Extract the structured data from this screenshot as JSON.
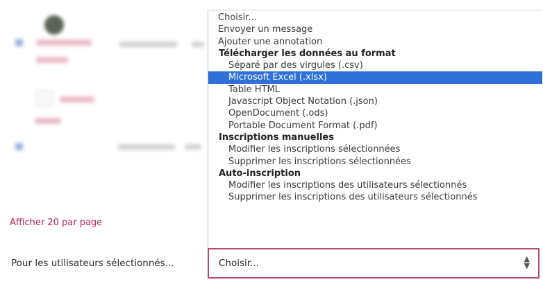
{
  "afficher_link": "Afficher 20 par page",
  "bulk_action_label": "Pour les utilisateurs sélectionnés...",
  "select": {
    "value": "Choisir..."
  },
  "dropdown": {
    "items": [
      {
        "label": "Choisir...",
        "type": "option",
        "indent": false,
        "selected": false
      },
      {
        "label": "Envoyer un message",
        "type": "option",
        "indent": false,
        "selected": false
      },
      {
        "label": "Ajouter une annotation",
        "type": "option",
        "indent": false,
        "selected": false
      },
      {
        "label": "Télécharger les données au format",
        "type": "group",
        "indent": false,
        "selected": false
      },
      {
        "label": "Séparé par des virgules (.csv)",
        "type": "option",
        "indent": true,
        "selected": false
      },
      {
        "label": "Microsoft Excel (.xlsx)",
        "type": "option",
        "indent": true,
        "selected": true
      },
      {
        "label": "Table HTML",
        "type": "option",
        "indent": true,
        "selected": false
      },
      {
        "label": "Javascript Object Notation (.json)",
        "type": "option",
        "indent": true,
        "selected": false
      },
      {
        "label": "OpenDocument (.ods)",
        "type": "option",
        "indent": true,
        "selected": false
      },
      {
        "label": "Portable Document Format (.pdf)",
        "type": "option",
        "indent": true,
        "selected": false
      },
      {
        "label": "Inscriptions manuelles",
        "type": "group",
        "indent": false,
        "selected": false
      },
      {
        "label": "Modifier les inscriptions sélectionnées",
        "type": "option",
        "indent": true,
        "selected": false
      },
      {
        "label": "Supprimer les inscriptions sélectionnées",
        "type": "option",
        "indent": true,
        "selected": false
      },
      {
        "label": "Auto-inscription",
        "type": "group",
        "indent": false,
        "selected": false
      },
      {
        "label": "Modifier les inscriptions des utilisateurs sélectionnés",
        "type": "option",
        "indent": true,
        "selected": false
      },
      {
        "label": "Supprimer les inscriptions des utilisateurs sélectionnés",
        "type": "option",
        "indent": true,
        "selected": false
      }
    ]
  },
  "colors": {
    "accent": "#b5294f",
    "selected_bg": "#2e6fd8",
    "select_border": "#b44a72"
  },
  "icons": {
    "select_arrow": "sort-arrows-icon",
    "avatar": "user-avatar"
  }
}
